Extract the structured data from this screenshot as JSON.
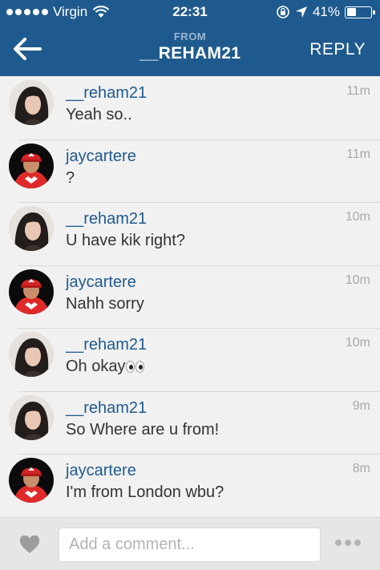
{
  "status_bar": {
    "carrier": "Virgin",
    "time": "22:31",
    "battery_text": "41%",
    "battery_level": 0.41,
    "icons": [
      "signal-dots",
      "wifi-icon",
      "rotation-lock-icon",
      "location-arrow-icon",
      "battery-icon"
    ]
  },
  "header": {
    "from_label": "FROM",
    "username": "__REHAM21",
    "reply_label": "REPLY",
    "back_icon": "back-arrow-icon"
  },
  "messages": [
    {
      "user": "__reham21",
      "text": "Yeah so..",
      "time": "11m",
      "avatar": "reham"
    },
    {
      "user": "jaycartere",
      "text": "?",
      "time": "11m",
      "avatar": "jay"
    },
    {
      "user": "__reham21",
      "text": "U have kik right?",
      "time": "10m",
      "avatar": "reham"
    },
    {
      "user": "jaycartere",
      "text": "Nahh sorry",
      "time": "10m",
      "avatar": "jay"
    },
    {
      "user": "__reham21",
      "text": "Oh okay",
      "emoji": "eyes-emoji",
      "time": "10m",
      "avatar": "reham"
    },
    {
      "user": "__reham21",
      "text": "So Where are u from!",
      "time": "9m",
      "avatar": "reham"
    },
    {
      "user": "jaycartere",
      "text": "I'm from London wbu?",
      "time": "8m",
      "avatar": "jay"
    }
  ],
  "composer": {
    "placeholder": "Add a comment...",
    "like_icon": "heart-icon",
    "more_icon": "more-dots-icon"
  },
  "colors": {
    "header_bg": "#1f5a8e",
    "username": "#1f5a8e",
    "background": "#f1f1f1"
  }
}
